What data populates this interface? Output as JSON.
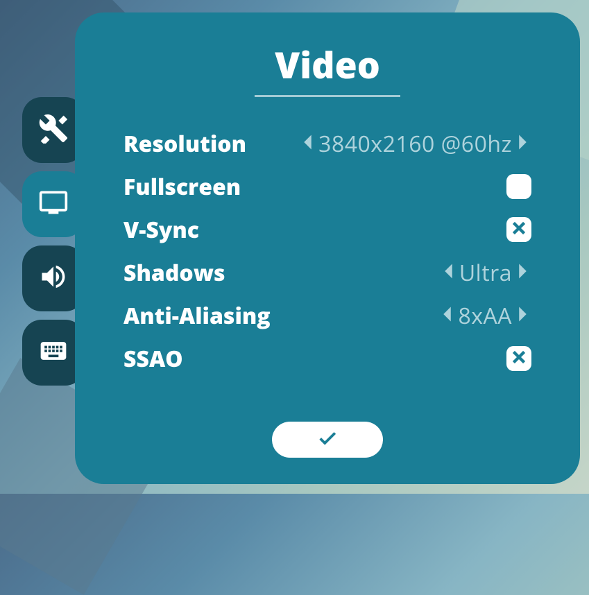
{
  "panel": {
    "title": "Video"
  },
  "sidebar": {
    "tabs": [
      "general",
      "video",
      "audio",
      "controls"
    ],
    "active_index": 1
  },
  "settings": {
    "resolution": {
      "label": "Resolution",
      "value": "3840x2160 @60hz"
    },
    "fullscreen": {
      "label": "Fullscreen",
      "checked": false
    },
    "vsync": {
      "label": "V-Sync",
      "checked": true
    },
    "shadows": {
      "label": "Shadows",
      "value": "Ultra"
    },
    "antialiasing": {
      "label": "Anti-Aliasing",
      "value": "8xAA"
    },
    "ssao": {
      "label": "SSAO",
      "checked": true
    }
  }
}
